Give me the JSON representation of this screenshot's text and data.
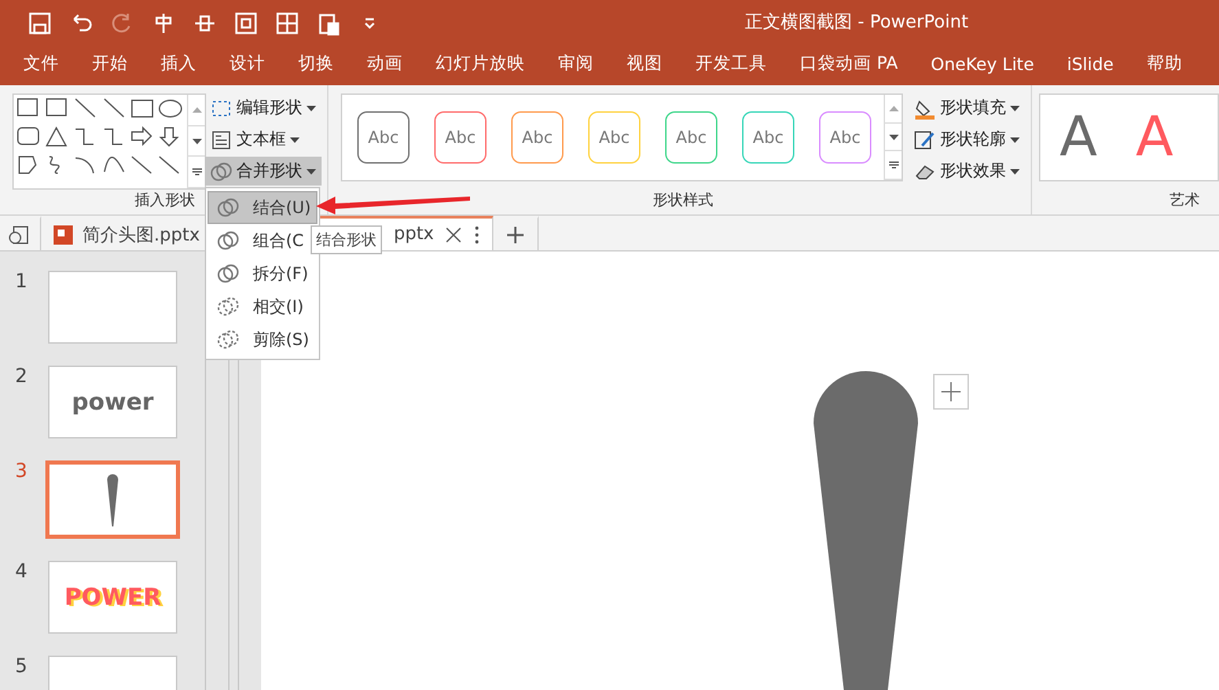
{
  "title_bar": {
    "title": "正文横图截图  -  PowerPoint"
  },
  "menu_tabs": [
    {
      "label": "文件",
      "selected": false
    },
    {
      "label": "开始",
      "selected": false
    },
    {
      "label": "插入",
      "selected": false
    },
    {
      "label": "设计",
      "selected": false
    },
    {
      "label": "切换",
      "selected": false
    },
    {
      "label": "动画",
      "selected": false
    },
    {
      "label": "幻灯片放映",
      "selected": false
    },
    {
      "label": "审阅",
      "selected": false
    },
    {
      "label": "视图",
      "selected": false
    },
    {
      "label": "开发工具",
      "selected": false
    },
    {
      "label": "口袋动画 PA",
      "selected": false
    },
    {
      "label": "OneKey Lite",
      "selected": false
    },
    {
      "label": "iSlide",
      "selected": false
    },
    {
      "label": "帮助",
      "selected": false
    }
  ],
  "ribbon": {
    "insert_shapes": {
      "label": "插入形状"
    },
    "shape_buttons": [
      {
        "label": "编辑形状",
        "active": false
      },
      {
        "label": "文本框",
        "active": false
      },
      {
        "label": "合并形状",
        "active": true
      }
    ],
    "shape_styles": {
      "label": "形状样式",
      "samples": [
        {
          "text": "Abc",
          "color": "#707070"
        },
        {
          "text": "Abc",
          "color": "#ff6b6b"
        },
        {
          "text": "Abc",
          "color": "#ff9a4d"
        },
        {
          "text": "Abc",
          "color": "#ffd23f"
        },
        {
          "text": "Abc",
          "color": "#3ed68a"
        },
        {
          "text": "Abc",
          "color": "#36d6b8"
        },
        {
          "text": "Abc",
          "color": "#d98cff"
        }
      ]
    },
    "format_buttons": [
      {
        "label": "形状填充"
      },
      {
        "label": "形状轮廓"
      },
      {
        "label": "形状效果"
      }
    ],
    "art": {
      "label": "艺术",
      "samples": [
        {
          "text": "A",
          "color": "#6b6b6b"
        },
        {
          "text": "A",
          "color": "#ff5a5f"
        }
      ]
    }
  },
  "doc_tabs": [
    {
      "label": "简介头图.pptx",
      "selected": false
    },
    {
      "label": "pptx",
      "selected": true
    }
  ],
  "merge_menu": {
    "items": [
      {
        "label": "结合(U)",
        "selected": true
      },
      {
        "label": "组合(C",
        "selected": false
      },
      {
        "label": "拆分(F)",
        "selected": false
      },
      {
        "label": "相交(I)",
        "selected": false
      },
      {
        "label": "剪除(S)",
        "selected": false
      }
    ],
    "tooltip": "结合形状"
  },
  "slides": [
    {
      "number": "1",
      "selected": false,
      "kind": "blank"
    },
    {
      "number": "2",
      "selected": false,
      "kind": "text",
      "text": "power"
    },
    {
      "number": "3",
      "selected": true,
      "kind": "shape"
    },
    {
      "number": "4",
      "selected": false,
      "kind": "colortext",
      "text": "POWER"
    },
    {
      "number": "5",
      "selected": false,
      "kind": "blank"
    }
  ]
}
